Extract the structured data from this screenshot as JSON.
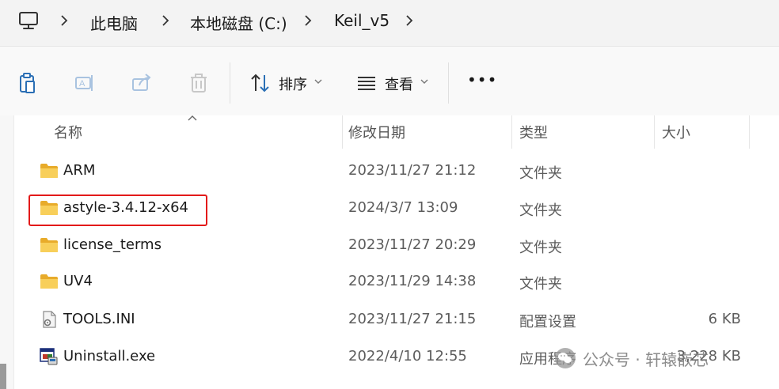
{
  "breadcrumb": {
    "items": [
      "此电脑",
      "本地磁盘 (C:)",
      "Keil_v5"
    ]
  },
  "toolbar": {
    "sort_label": "排序",
    "view_label": "查看",
    "more_label": "•••"
  },
  "columns": {
    "name": "名称",
    "date": "修改日期",
    "type": "类型",
    "size": "大小"
  },
  "files": [
    {
      "name": "ARM",
      "date": "2023/11/27 21:12",
      "type": "文件夹",
      "size": "",
      "icon": "folder-icon"
    },
    {
      "name": "astyle-3.4.12-x64",
      "date": "2024/3/7 13:09",
      "type": "文件夹",
      "size": "",
      "icon": "folder-icon"
    },
    {
      "name": "license_terms",
      "date": "2023/11/27 20:29",
      "type": "文件夹",
      "size": "",
      "icon": "folder-icon"
    },
    {
      "name": "UV4",
      "date": "2023/11/29 14:38",
      "type": "文件夹",
      "size": "",
      "icon": "folder-icon"
    },
    {
      "name": "TOOLS.INI",
      "date": "2023/11/27 21:15",
      "type": "配置设置",
      "size": "6 KB",
      "icon": "ini-file-icon"
    },
    {
      "name": "Uninstall.exe",
      "date": "2022/4/10 12:55",
      "type": "应用程序",
      "size": "3,228 KB",
      "icon": "exe-file-icon"
    }
  ],
  "watermark": {
    "text": "公众号 · 轩辕嵌芯"
  },
  "colors": {
    "highlight": "#e31a1a",
    "folder": "#f5c445"
  }
}
